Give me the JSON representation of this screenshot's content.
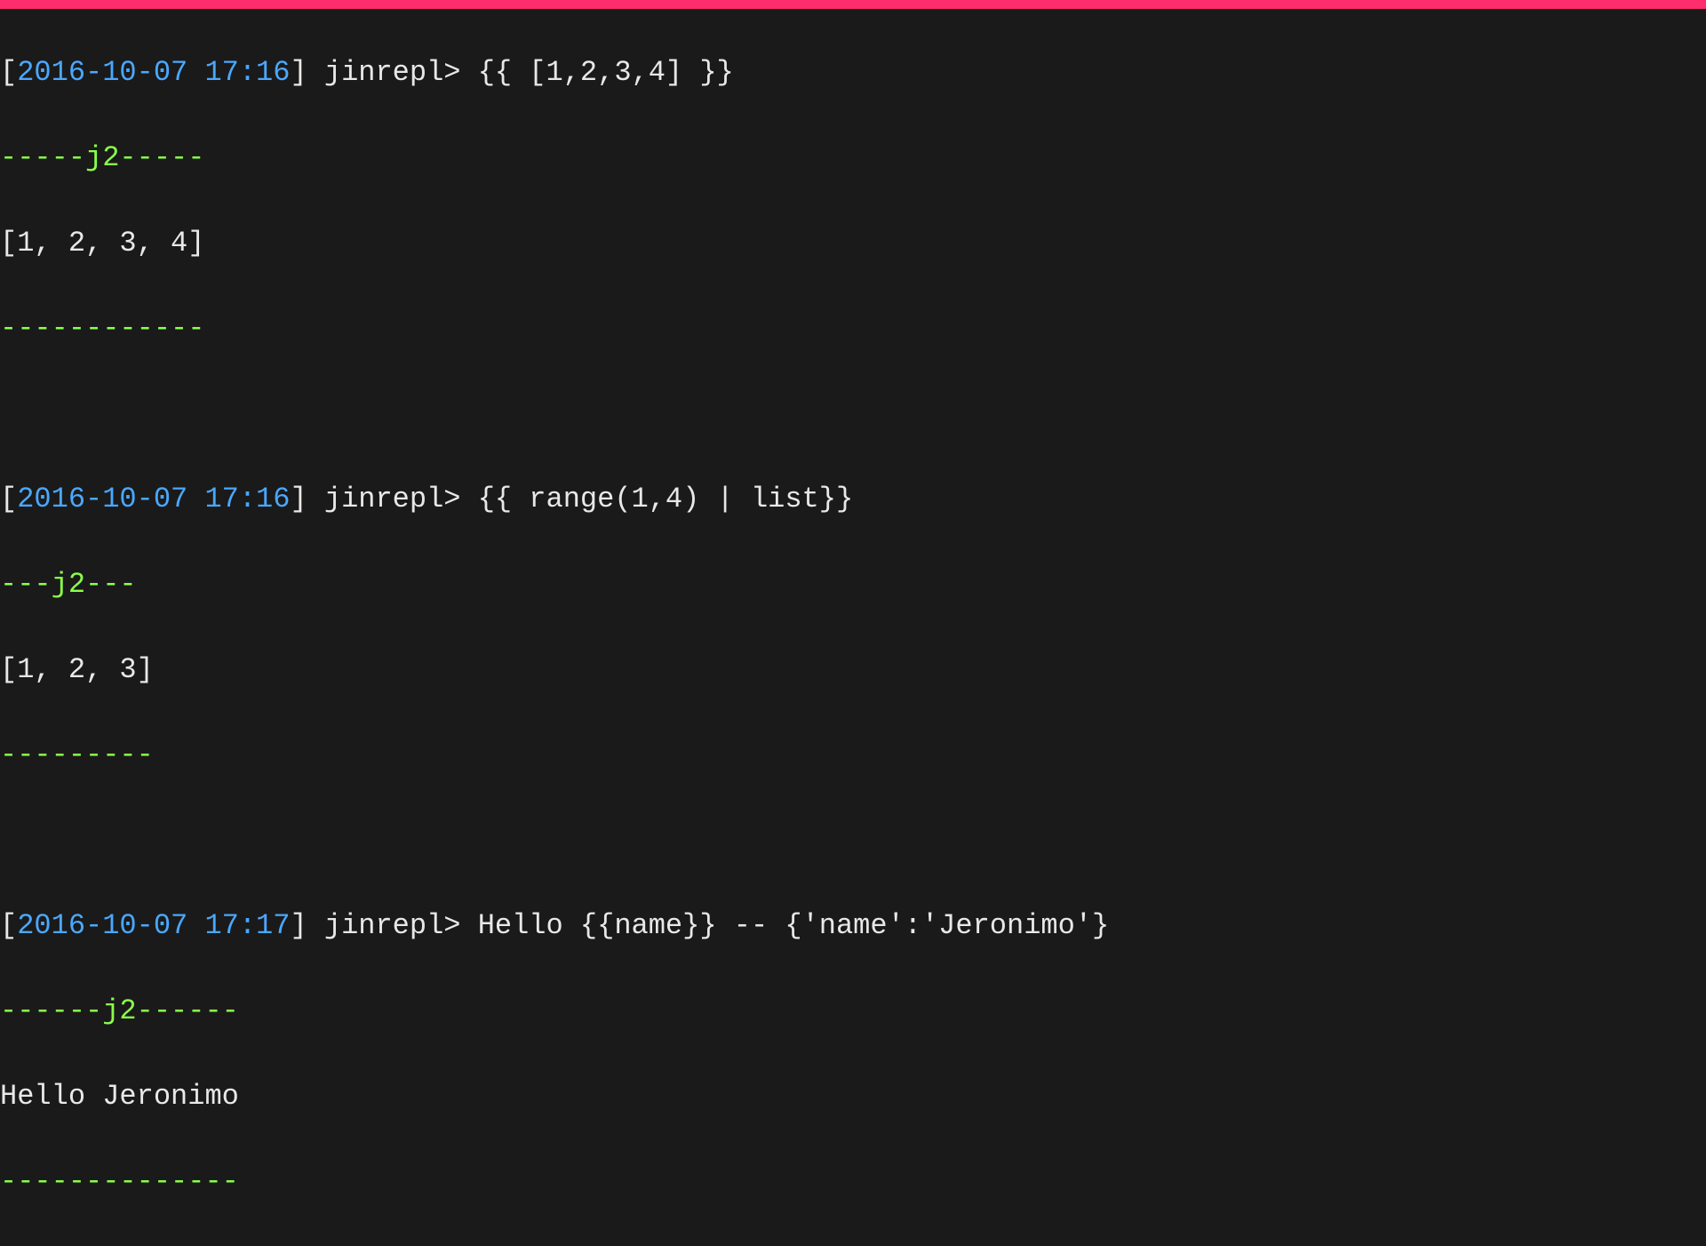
{
  "colors": {
    "background": "#1a1a1a",
    "foreground": "#e8e8e8",
    "timestamp": "#4aa8ff",
    "accent_green": "#8aff4a",
    "titlebar": "#ff2d6c"
  },
  "prompt_name": "jinrepl>",
  "entries": [
    {
      "timestamp": "2016-10-07 17:16",
      "input": "{{ [1,2,3,4] }}",
      "header": "-----j2-----",
      "output": "[1, 2, 3, 4]",
      "footer": "------------"
    },
    {
      "timestamp": "2016-10-07 17:16",
      "input": "{{ range(1,4) | list}}",
      "header": "---j2---",
      "output": "[1, 2, 3]",
      "footer": "---------"
    },
    {
      "timestamp": "2016-10-07 17:17",
      "input": "Hello {{name}} -- {'name':'Jeronimo'}",
      "header": "------j2------",
      "output": "Hello Jeronimo",
      "footer": "--------------"
    }
  ]
}
